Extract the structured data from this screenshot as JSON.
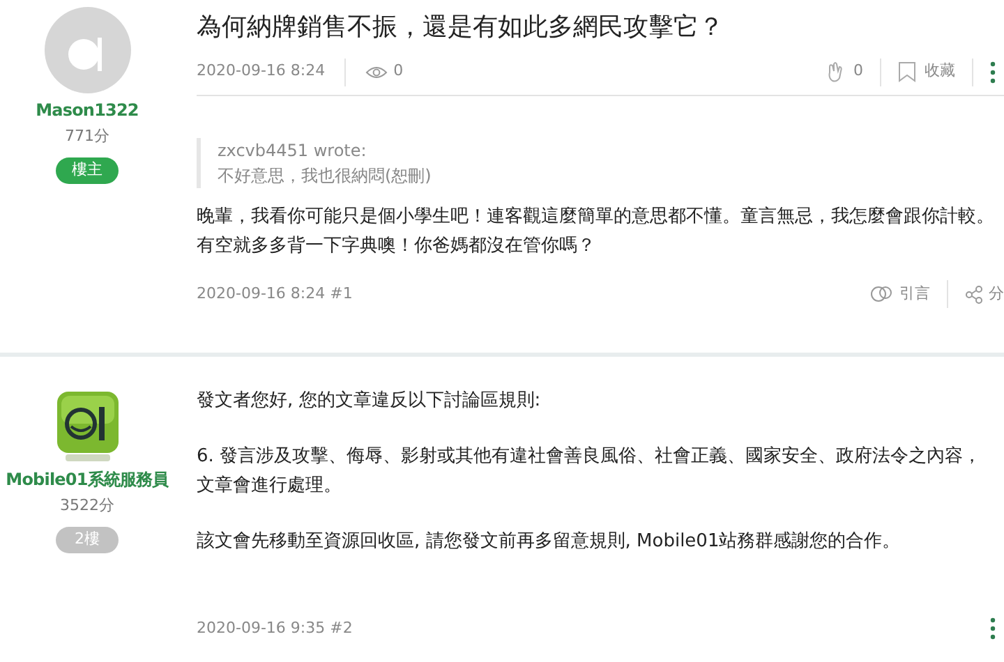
{
  "title": "為何納牌銷售不振，還是有如此多網民攻擊它？",
  "posts": [
    {
      "avatar": {
        "kind": "default"
      },
      "author": "Mason1322",
      "score": "771分",
      "badge": {
        "label": "樓主",
        "kind": "owner"
      },
      "header": {
        "date": "2020-09-16 8:24",
        "views": "0",
        "likes": "0",
        "bookmark": "收藏"
      },
      "quote": {
        "author": "zxcvb4451 wrote:",
        "text": "不好意思，我也很納悶(恕刪)"
      },
      "paragraphs": [
        "晚輩，我看你可能只是個小學生吧！連客觀這麼簡單的意思都不懂。童言無忌，我怎麼會跟你計較。有空就多多背一下字典噢！你爸媽都沒在管你嗎？"
      ],
      "footer": "2020-09-16 8:24 #1",
      "actions": {
        "quote": "引言",
        "share": "分"
      }
    },
    {
      "avatar": {
        "kind": "mascot"
      },
      "author": "Mobile01系統服務員",
      "score": "3522分",
      "badge": {
        "label": "2樓",
        "kind": "floor"
      },
      "paragraphs": [
        "發文者您好, 您的文章違反以下討論區規則:",
        "6. 發言涉及攻擊、侮辱、影射或其他有違社會善良風俗、社會正義、國家安全、政府法令之內容，文章會進行處理。",
        "該文會先移動至資源回收區, 請您發文前再多留意規則, Mobile01站務群感謝您的合作。"
      ],
      "footer": "2020-09-16 9:35 #2",
      "more": true
    }
  ]
}
